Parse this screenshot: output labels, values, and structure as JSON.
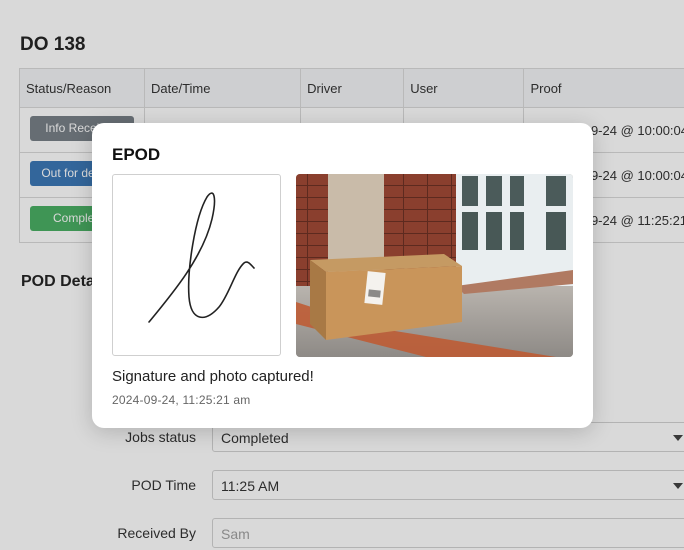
{
  "page": {
    "do_title": "DO 138",
    "table": {
      "headers": [
        "Status/Reason",
        "Date/Time",
        "Driver",
        "User",
        "Proof"
      ],
      "rows": [
        {
          "status": "Info Received",
          "status_color": "#6c757d",
          "proof": "2024-09-24 @ 10:00:04"
        },
        {
          "status": "Out for delivery",
          "status_color": "#2b6cb0",
          "proof": "2024-09-24 @ 10:00:04"
        },
        {
          "status": "Completed",
          "status_color": "#3aa856",
          "proof": "2024-09-24 @ 11:25:21"
        }
      ]
    },
    "pod_title": "POD Details",
    "form": {
      "jobs_status": {
        "label": "Jobs status",
        "value": "Completed"
      },
      "pod_time": {
        "label": "POD Time",
        "value": "11:25 AM"
      },
      "received_by": {
        "label": "Received By",
        "placeholder": "Sam"
      }
    }
  },
  "modal": {
    "title": "EPOD",
    "message": "Signature and photo captured!",
    "timestamp": "2024-09-24, 11:25:21 am"
  },
  "colors": {
    "overlay": "rgba(80,80,80,0.22)",
    "status_info": "#6c757d",
    "status_out": "#2b6cb0",
    "status_completed": "#3aa856"
  }
}
